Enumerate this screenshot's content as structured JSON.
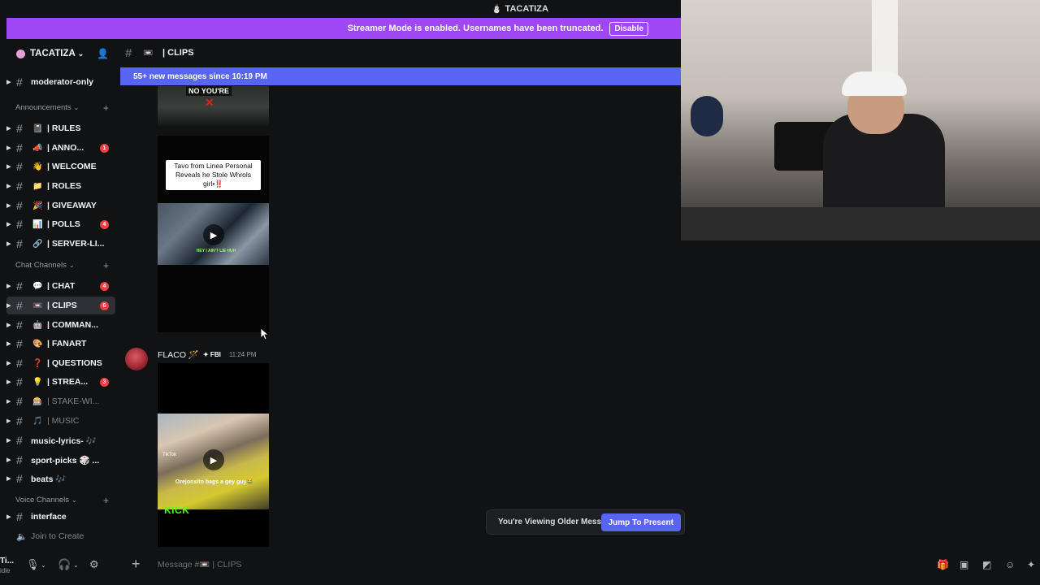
{
  "window": {
    "title": "TACATIZA"
  },
  "streamer_banner": {
    "text": "Streamer Mode is enabled. Usernames have been truncated.",
    "button": "Disable"
  },
  "server": {
    "name": "TACATIZA"
  },
  "sidebar": {
    "top_channel": {
      "label": "moderator-only"
    },
    "categories": {
      "announcements": "Announcements",
      "chat": "Chat Channels",
      "voice": "Voice Channels"
    },
    "channels": [
      {
        "emoji": "📓",
        "label": "| RULES",
        "badge": ""
      },
      {
        "emoji": "📣",
        "label": "| ANNO...",
        "badge": "1"
      },
      {
        "emoji": "👋",
        "label": "| WELCOME",
        "badge": ""
      },
      {
        "emoji": "📁",
        "label": "| ROLES",
        "badge": ""
      },
      {
        "emoji": "🎉",
        "label": "| GIVEAWAY",
        "badge": ""
      },
      {
        "emoji": "📊",
        "label": "| POLLS",
        "badge": "4"
      },
      {
        "emoji": "🔗",
        "label": "| SERVER-LI...",
        "badge": ""
      },
      {
        "emoji": "💬",
        "label": "| CHAT",
        "badge": "4"
      },
      {
        "emoji": "📼",
        "label": "| CLIPS",
        "badge": "6"
      },
      {
        "emoji": "🤖",
        "label": "| COMMAN...",
        "badge": ""
      },
      {
        "emoji": "🎨",
        "label": "| FANART",
        "badge": ""
      },
      {
        "emoji": "❓",
        "label": "| QUESTIONS",
        "badge": ""
      },
      {
        "emoji": "💡",
        "label": "| STREA...",
        "badge": "3"
      },
      {
        "emoji": "🎰",
        "label": "| STAKE-WI...",
        "badge": ""
      },
      {
        "emoji": "🎵",
        "label": "| MUSIC",
        "badge": ""
      },
      {
        "emoji": "",
        "label": "music-lyrics- 🎶",
        "badge": ""
      },
      {
        "emoji": "",
        "label": "sport-picks 🎲 ...",
        "badge": ""
      },
      {
        "emoji": "",
        "label": "beats 🎶",
        "badge": ""
      }
    ],
    "voice": {
      "interface": "interface",
      "join": "Join to Create"
    }
  },
  "user_panel": {
    "name": "Ti...",
    "status": "idle"
  },
  "channel_header": {
    "emoji": "📼",
    "title": "| CLIPS"
  },
  "new_messages_bar": {
    "text": "55+ new messages since 10:19 PM"
  },
  "messages": {
    "clip1": {
      "top_text": "NO YOU'RE"
    },
    "clip2": {
      "caption": "Tavo from Linea Personal Reveals he Stole Whrols girl•‼️",
      "overlay": "HEY I AIN'T LIE HUH"
    },
    "author": {
      "name": "FLACO 🪄",
      "tag": "✦ FBI",
      "time": "11:24 PM"
    },
    "clip3": {
      "overlay": "Orejonsito bags a gey guy😂",
      "brand": "KICK",
      "tiktok": "TikTok"
    }
  },
  "older_messages": {
    "text": "You're Viewing Older Messages",
    "button": "Jump To Present"
  },
  "composer": {
    "placeholder": "Message #📼 | CLIPS"
  },
  "colors": {
    "accent": "#5865f2",
    "streamer": "#a047f5",
    "badge": "#f23f43",
    "bg": "#111214"
  }
}
